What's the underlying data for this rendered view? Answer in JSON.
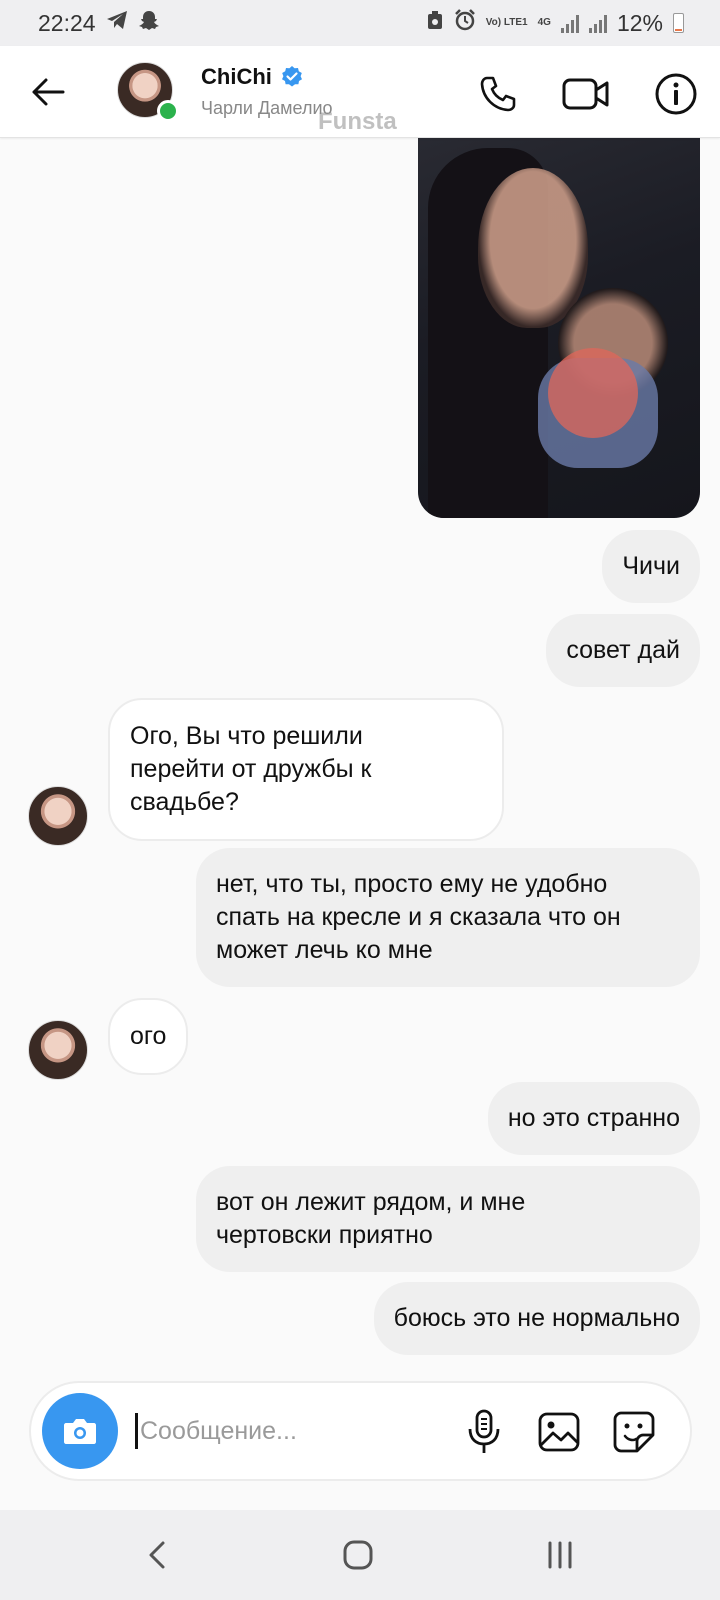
{
  "status_bar": {
    "time": "22:24",
    "network_label": "Vo) LTE1",
    "net_type": "4G",
    "battery": "12%",
    "battery_level": 0.12
  },
  "header": {
    "name": "ChiChi",
    "subtitle": "Чарли Дамелио",
    "watermark": "Funsta",
    "online": true
  },
  "messages": [
    {
      "type": "media",
      "direction": "out"
    },
    {
      "type": "text",
      "direction": "out",
      "text": "Чичи"
    },
    {
      "type": "text",
      "direction": "out",
      "text": "совет дай"
    },
    {
      "type": "text",
      "direction": "in",
      "text": "Ого, Вы что решили\nперейти от дружбы к\nсвадьбе?"
    },
    {
      "type": "text",
      "direction": "out",
      "text": "нет, что ты, просто ему не удобно\nспать на кресле и я сказала что он\nможет лечь ко мне"
    },
    {
      "type": "text",
      "direction": "in",
      "text": "ого"
    },
    {
      "type": "text",
      "direction": "out",
      "text": "но это странно"
    },
    {
      "type": "text",
      "direction": "out",
      "text": "вот он лежит рядом, и мне\nчертовски приятно"
    },
    {
      "type": "text",
      "direction": "out",
      "text": "боюсь это не нормально"
    }
  ],
  "composer": {
    "placeholder": "Сообщение..."
  },
  "colors": {
    "accent": "#3897f0",
    "online": "#2bb24c",
    "verified": "#3897f0"
  }
}
